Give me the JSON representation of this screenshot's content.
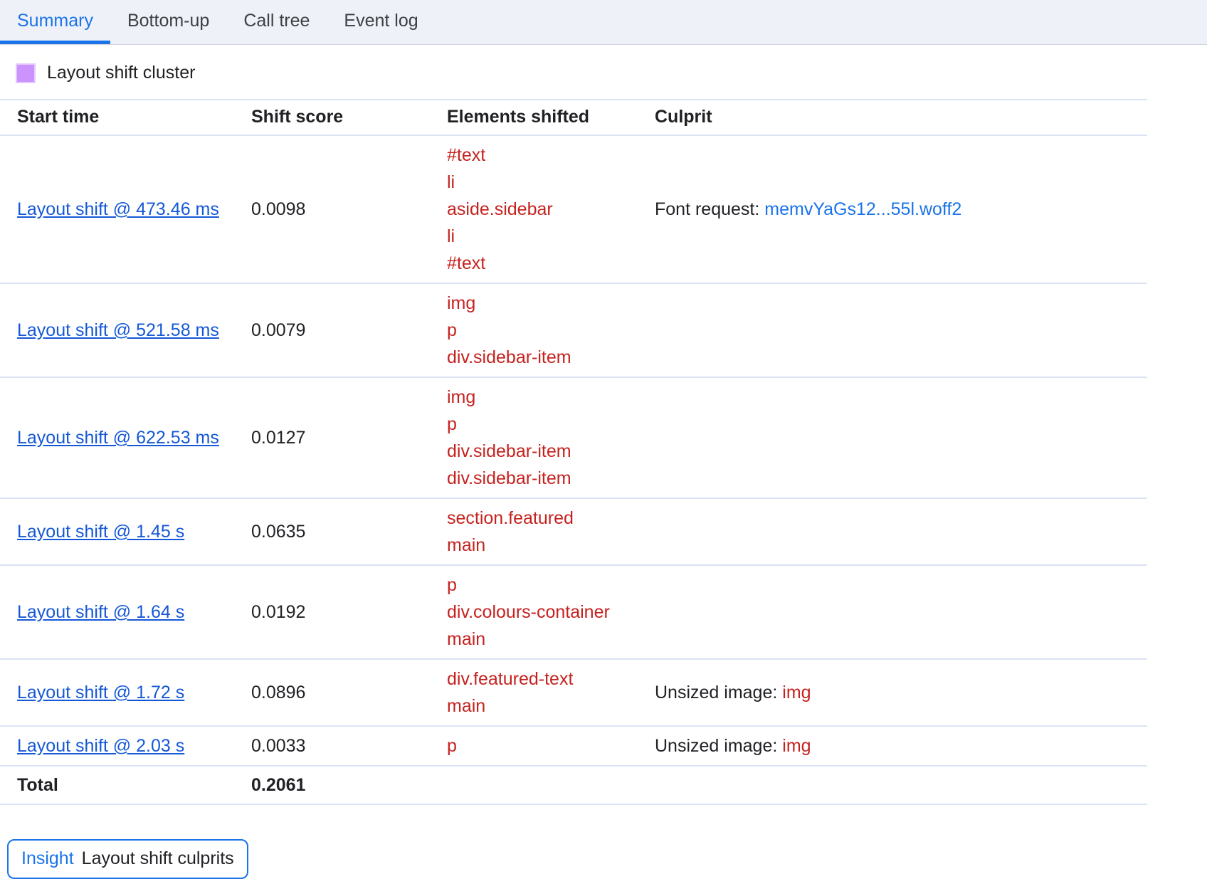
{
  "tabs": [
    {
      "label": "Summary",
      "selected": true
    },
    {
      "label": "Bottom-up",
      "selected": false
    },
    {
      "label": "Call tree",
      "selected": false
    },
    {
      "label": "Event log",
      "selected": false
    }
  ],
  "legend": {
    "label": "Layout shift cluster",
    "color": "#cc93fc"
  },
  "table": {
    "headers": {
      "start_time": "Start time",
      "shift_score": "Shift score",
      "elements_shifted": "Elements shifted",
      "culprit": "Culprit"
    },
    "rows": [
      {
        "start_time": "Layout shift @ 473.46 ms",
        "shift_score": "0.0098",
        "elements": [
          "#text",
          "li",
          "aside.sidebar",
          "li",
          "#text"
        ],
        "culprit_label": "Font request:",
        "culprit_value": "memvYaGs12...55l.woff2",
        "culprit_value_kind": "request"
      },
      {
        "start_time": "Layout shift @ 521.58 ms",
        "shift_score": "0.0079",
        "elements": [
          "img",
          "p",
          "div.sidebar-item"
        ],
        "culprit_label": "",
        "culprit_value": "",
        "culprit_value_kind": "none"
      },
      {
        "start_time": "Layout shift @ 622.53 ms",
        "shift_score": "0.0127",
        "elements": [
          "img",
          "p",
          "div.sidebar-item",
          "div.sidebar-item"
        ],
        "culprit_label": "",
        "culprit_value": "",
        "culprit_value_kind": "none"
      },
      {
        "start_time": "Layout shift @ 1.45 s",
        "shift_score": "0.0635",
        "elements": [
          "section.featured",
          "main"
        ],
        "culprit_label": "",
        "culprit_value": "",
        "culprit_value_kind": "none"
      },
      {
        "start_time": "Layout shift @ 1.64 s",
        "shift_score": "0.0192",
        "elements": [
          "p",
          "div.colours-container",
          "main"
        ],
        "culprit_label": "",
        "culprit_value": "",
        "culprit_value_kind": "none"
      },
      {
        "start_time": "Layout shift @ 1.72 s",
        "shift_score": "0.0896",
        "elements": [
          "div.featured-text",
          "main"
        ],
        "culprit_label": "Unsized image:",
        "culprit_value": "img",
        "culprit_value_kind": "node"
      },
      {
        "start_time": "Layout shift @ 2.03 s",
        "shift_score": "0.0033",
        "elements": [
          "p"
        ],
        "culprit_label": "Unsized image:",
        "culprit_value": "img",
        "culprit_value_kind": "node"
      }
    ],
    "total": {
      "label": "Total",
      "shift_score": "0.2061"
    }
  },
  "insight": {
    "key": "Insight",
    "value": "Layout shift culprits"
  },
  "colors": {
    "link": "#1558d6",
    "node": "#c5221f",
    "accent": "#1a73e8",
    "divider": "#dbe3f4",
    "tabbar_bg": "#eef1f8"
  }
}
